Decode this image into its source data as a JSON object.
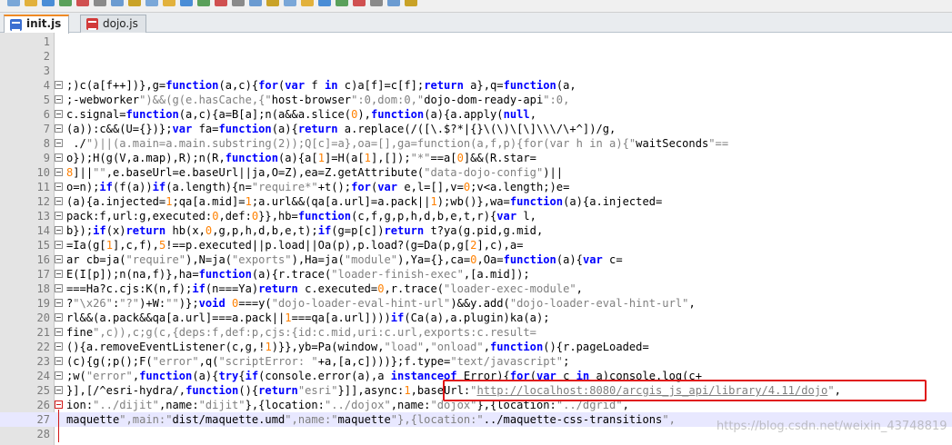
{
  "tabs": [
    {
      "label": "init.js",
      "active": true,
      "icon": "js-file-icon",
      "color": "#3b6fd1"
    },
    {
      "label": "dojo.js",
      "active": false,
      "icon": "js-file-icon",
      "color": "#d23a3a"
    }
  ],
  "toolbar_icons": [
    "new-file-icon",
    "open-icon",
    "save-icon",
    "save-all-icon",
    "close-icon",
    "print-icon",
    "cut-icon",
    "copy-icon",
    "paste-icon",
    "undo-icon",
    "redo-icon",
    "find-icon",
    "replace-icon",
    "zoom-in-icon",
    "zoom-out-icon",
    "sync-icon",
    "wrap-icon",
    "indent-icon",
    "bookmark-icon",
    "macro-icon",
    "record-icon",
    "play-icon",
    "stop-icon",
    "run-icon"
  ],
  "editor": {
    "lines": [
      {
        "n": "1",
        "text": ""
      },
      {
        "n": "2",
        "text": ""
      },
      {
        "n": "3",
        "text": ""
      },
      {
        "n": "4",
        "text": ";)c(a[f++])},g=function(a,c){for(var f in c)a[f]=c[f];return a},q=function(a,"
      },
      {
        "n": "5",
        "text": ";-webworker\")&&(g(e.hasCache,{\"host-browser\":0,dom:0,\"dojo-dom-ready-api\":0,"
      },
      {
        "n": "6",
        "text": "c.signal=function(a,c){a=B[a];n(a&&a.slice(0),function(a){a.apply(null,"
      },
      {
        "n": "7",
        "text": "(a)):c&&(U={})};var fa=function(a){return a.replace(/([\\.$?*|{}\\(\\)\\[\\]\\\\\\/\\+^])/g,"
      },
      {
        "n": "8",
        "text": " ./\")||(a.main=a.main.substring(2));Q[c]=a},oa=[],ga=function(a,f,p){for(var h in a){\"waitSeconds\"=="
      },
      {
        "n": "9",
        "text": "o});H(g(V,a.map),R);n(R,function(a){a[1]=H(a[1],[]);\"*\"==a[0]&&(R.star="
      },
      {
        "n": "10",
        "text": "8]||\"\",e.baseUrl=e.baseUrl||ja,O=Z),ea=Z.getAttribute(\"data-dojo-config\")||"
      },
      {
        "n": "11",
        "text": "o=n);if(f(a))if(a.length){n=\"require*\"+t();for(var e,l=[],v=0;v<a.length;)e="
      },
      {
        "n": "12",
        "text": "(a){a.injected=1;qa[a.mid]=1;a.url&&(qa[a.url]=a.pack||1);wb()},wa=function(a){a.injected="
      },
      {
        "n": "13",
        "text": "pack:f,url:g,executed:0,def:0}},hb=function(c,f,g,p,h,d,b,e,t,r){var l,"
      },
      {
        "n": "14",
        "text": "b});if(x)return hb(x,0,g,p,h,d,b,e,t);if(g=p[c])return t?ya(g.pid,g.mid,"
      },
      {
        "n": "15",
        "text": "=Ia(g[1],c,f),5!==p.executed||p.load||Oa(p),p.load?(g=Da(p,g[2],c),a="
      },
      {
        "n": "16",
        "text": "ar cb=ja(\"require\"),N=ja(\"exports\"),Ha=ja(\"module\"),Ya={},ca=0,Oa=function(a){var c="
      },
      {
        "n": "17",
        "text": "E(I[p]);n(na,f)},ha=function(a){r.trace(\"loader-finish-exec\",[a.mid]);"
      },
      {
        "n": "18",
        "text": "===Ha?c.cjs:K(n,f);if(n===Ya)return c.executed=0,r.trace(\"loader-exec-module\","
      },
      {
        "n": "19",
        "text": "?\"\\x26\":\"?\")+W:\"\")};void 0===y(\"dojo-loader-eval-hint-url\")&&y.add(\"dojo-loader-eval-hint-url\","
      },
      {
        "n": "20",
        "text": "rl&&(a.pack&&qa[a.url]===a.pack||1===qa[a.url])))if(Ca(a),a.plugin)ka(a);"
      },
      {
        "n": "21",
        "text": "fine\",c)),c;g(c,{deps:f,def:p,cjs:{id:c.mid,uri:c.url,exports:c.result="
      },
      {
        "n": "22",
        "text": "(){a.removeEventListener(c,g,!1)}},yb=Pa(window,\"load\",\"onload\",function(){r.pageLoaded="
      },
      {
        "n": "23",
        "text": "(c){g(;p();F(\"error\",q(\"scriptError: \"+a,[a,c])))};f.type=\"text/javascript\";"
      },
      {
        "n": "24",
        "text": ";w(\"error\",function(a){try{if(console.error(a),a instanceof Error){for(var c in a)console.log(c+"
      },
      {
        "n": "25",
        "text": "}],[/^esri-hydra/,function(){return\"esri\"}]],async:1,baseUrl:\"http://localhost:8080/arcgis_js_api/library/4.11/dojo\","
      },
      {
        "n": "26",
        "text": "ion:\"../dijit\",name:\"dijit\"},{location:\"../dojox\",name:\"dojox\"},{location:\"../dgrid\","
      },
      {
        "n": "27",
        "text": "maquette\",main:\"dist/maquette.umd\",name:\"maquette\"},{location:\"../maquette-css-transitions\","
      },
      {
        "n": "28",
        "text": ""
      }
    ]
  },
  "watermark": "https://blog.csdn.net/weixin_43748819",
  "colors": {
    "keyword": "#0000ff",
    "string": "#808080",
    "number": "#ff8000",
    "callout": "#e01818",
    "active_tab_accent": "#f08a24"
  }
}
